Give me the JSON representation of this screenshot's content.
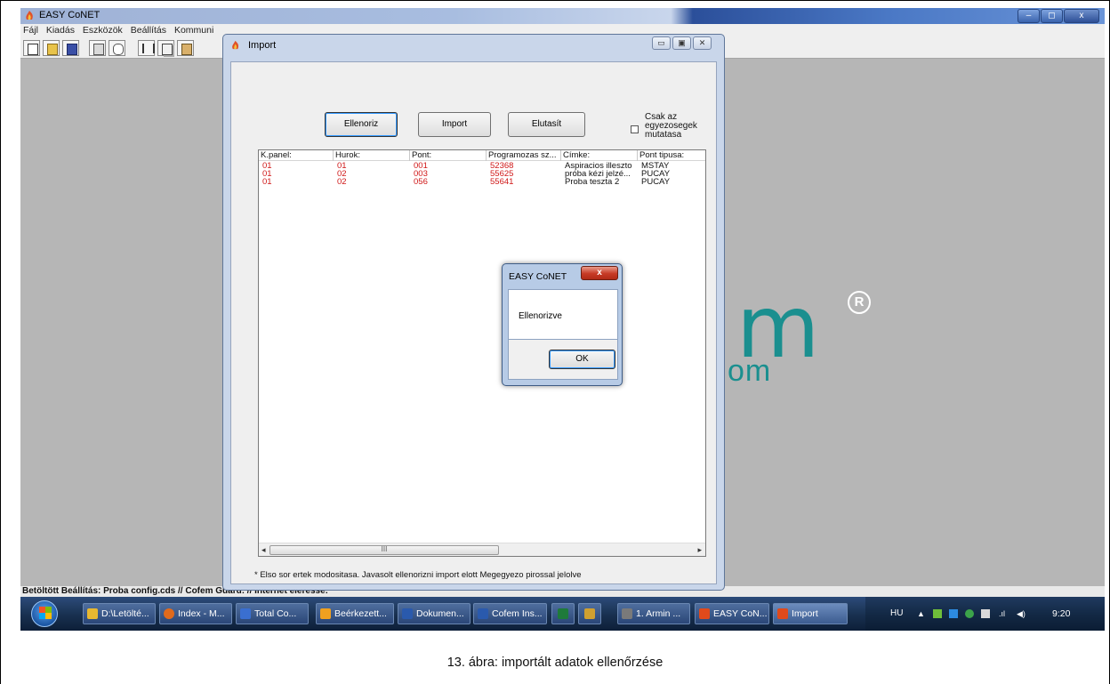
{
  "main_window": {
    "title": "EASY CoNET",
    "menu": [
      "Fájl",
      "Kiadás",
      "Eszközök",
      "Beállítás",
      "Kommuni"
    ],
    "min_label": "–",
    "max_label": "◻",
    "close_label": "x",
    "logo_m": "m",
    "logo_r": "R",
    "logo_com": "om",
    "status_text": "Betöltött Beállítás:  Proba config.cds // Cofem Guard: // Internet eleresse:"
  },
  "import_dialog": {
    "title": "Import",
    "buttons": {
      "check": "Ellenoriz",
      "import": "Import",
      "reject": "Elutasít"
    },
    "checkbox_label": "Csak az egyezosegek mutatasa",
    "columns": [
      "K.panel:",
      "Hurok:",
      "Pont:",
      "Programozas sz...",
      "Címke:",
      "Pont tipusa:"
    ],
    "rows": [
      {
        "panel": "01",
        "loop": "01",
        "point": "001",
        "prog": "52368",
        "label": "Aspiracios illeszto",
        "type": "MSTAY"
      },
      {
        "panel": "01",
        "loop": "02",
        "point": "003",
        "prog": "55625",
        "label": "próba kézi jelzé...",
        "type": "PUCAY"
      },
      {
        "panel": "01",
        "loop": "02",
        "point": "056",
        "prog": "55641",
        "label": "Proba teszta 2",
        "type": "PUCAY"
      }
    ],
    "scroll_thumb": "III",
    "note": "* Elso sor ertek modositasa. Javasolt ellenorizni import elott Megegyezo pirossal jelolve",
    "colors": {
      "highlight_row": "#d01818"
    }
  },
  "message_box": {
    "title": "EASY CoNET",
    "close_label": "x",
    "text": "Ellenorizve",
    "ok_label": "OK"
  },
  "taskbar": {
    "items": [
      {
        "label": "D:\\Letölté...",
        "icon_color": "#e8b830"
      },
      {
        "label": "Index - M...",
        "icon_color": "#e06a1c"
      },
      {
        "label": "Total Co...",
        "icon_color": "#3a6fd0"
      },
      {
        "label": "Beérkezett...",
        "icon_color": "#f0a020"
      },
      {
        "label": "Dokumen...",
        "icon_color": "#2a5aad"
      },
      {
        "label": "Cofem Ins...",
        "icon_color": "#2a5aad"
      },
      {
        "label": "",
        "icon_color": "#1e7a3a"
      },
      {
        "label": "",
        "icon_color": "#d0a030"
      },
      {
        "label": "1. Armin ...",
        "icon_color": "#7a7a7a"
      },
      {
        "label": "EASY CoN...",
        "icon_color": "#e04a1c"
      },
      {
        "label": "Import",
        "icon_color": "#e04a1c"
      }
    ],
    "lang": "HU",
    "clock": "9:20"
  },
  "caption": "13. ábra: importált adatok ellenőrzése"
}
